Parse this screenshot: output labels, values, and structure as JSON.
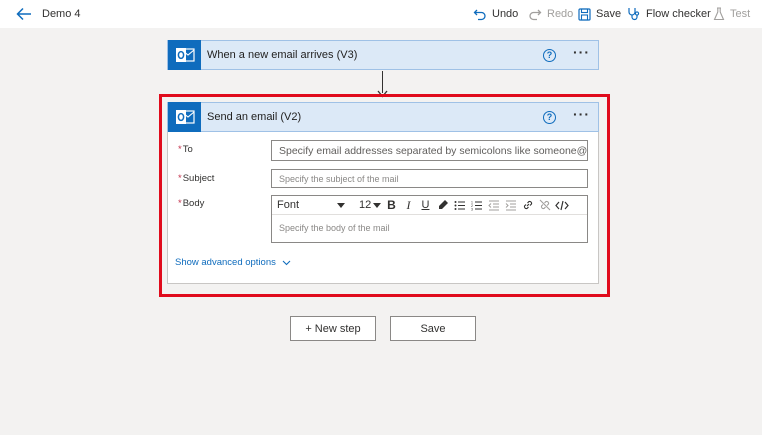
{
  "header": {
    "flow_name": "Demo 4",
    "undo": "Undo",
    "redo": "Redo",
    "save": "Save",
    "flow_checker": "Flow checker",
    "test": "Test"
  },
  "trigger": {
    "title": "When a new email arrives (V3)",
    "icon": "outlook-icon"
  },
  "action": {
    "title": "Send an email (V2)",
    "icon": "outlook-icon",
    "fields": {
      "to": {
        "required_mark": "*",
        "label": "To",
        "placeholder": "Specify email addresses separated by semicolons like someone@c..."
      },
      "subject": {
        "required_mark": "*",
        "label": "Subject",
        "placeholder": "Specify the subject of the mail"
      },
      "body": {
        "required_mark": "*",
        "label": "Body",
        "placeholder": "Specify the body of the mail",
        "font": "Font",
        "font_size": "12"
      }
    },
    "advanced_link": "Show advanced options"
  },
  "buttons": {
    "new_step": "+ New step",
    "save": "Save"
  },
  "colors": {
    "brand": "#0f6cbd",
    "card_header": "#dce9f7",
    "highlight": "#e00b1c"
  }
}
